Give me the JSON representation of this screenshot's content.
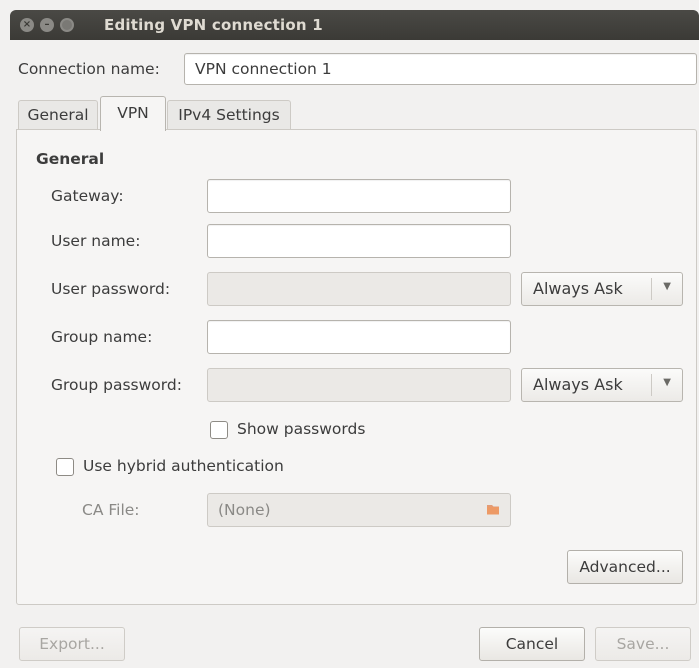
{
  "window": {
    "title": "Editing VPN connection 1",
    "controls": {
      "close": "×",
      "minimize": "–",
      "maximize": "□"
    }
  },
  "connection": {
    "name_label": "Connection name:",
    "name_value": "VPN connection 1"
  },
  "tabs": [
    {
      "label": "General",
      "active": false
    },
    {
      "label": "VPN",
      "active": true
    },
    {
      "label": "IPv4 Settings",
      "active": false
    }
  ],
  "vpn": {
    "section_title": "General",
    "gateway": {
      "label": "Gateway:",
      "value": ""
    },
    "user_name": {
      "label": "User name:",
      "value": ""
    },
    "user_password": {
      "label": "User password:",
      "value": "",
      "mode": "Always Ask"
    },
    "group_name": {
      "label": "Group name:",
      "value": ""
    },
    "group_password": {
      "label": "Group password:",
      "value": "",
      "mode": "Always Ask"
    },
    "show_passwords": {
      "label": "Show passwords",
      "checked": false
    },
    "hybrid_auth": {
      "label": "Use hybrid authentication",
      "checked": false
    },
    "ca_file": {
      "label": "CA File:",
      "value": "(None)"
    },
    "advanced_label": "Advanced..."
  },
  "footer": {
    "export_label": "Export...",
    "cancel_label": "Cancel",
    "save_label": "Save..."
  },
  "colors": {
    "titlebar": "#3b3a36",
    "window_bg": "#f2f1f0",
    "title_text": "#dfdbd2",
    "folder_icon": "#e0824f"
  },
  "icons": {
    "ca_file_picker": "folder-icon",
    "combo_arrow": "chevron-down-icon"
  }
}
